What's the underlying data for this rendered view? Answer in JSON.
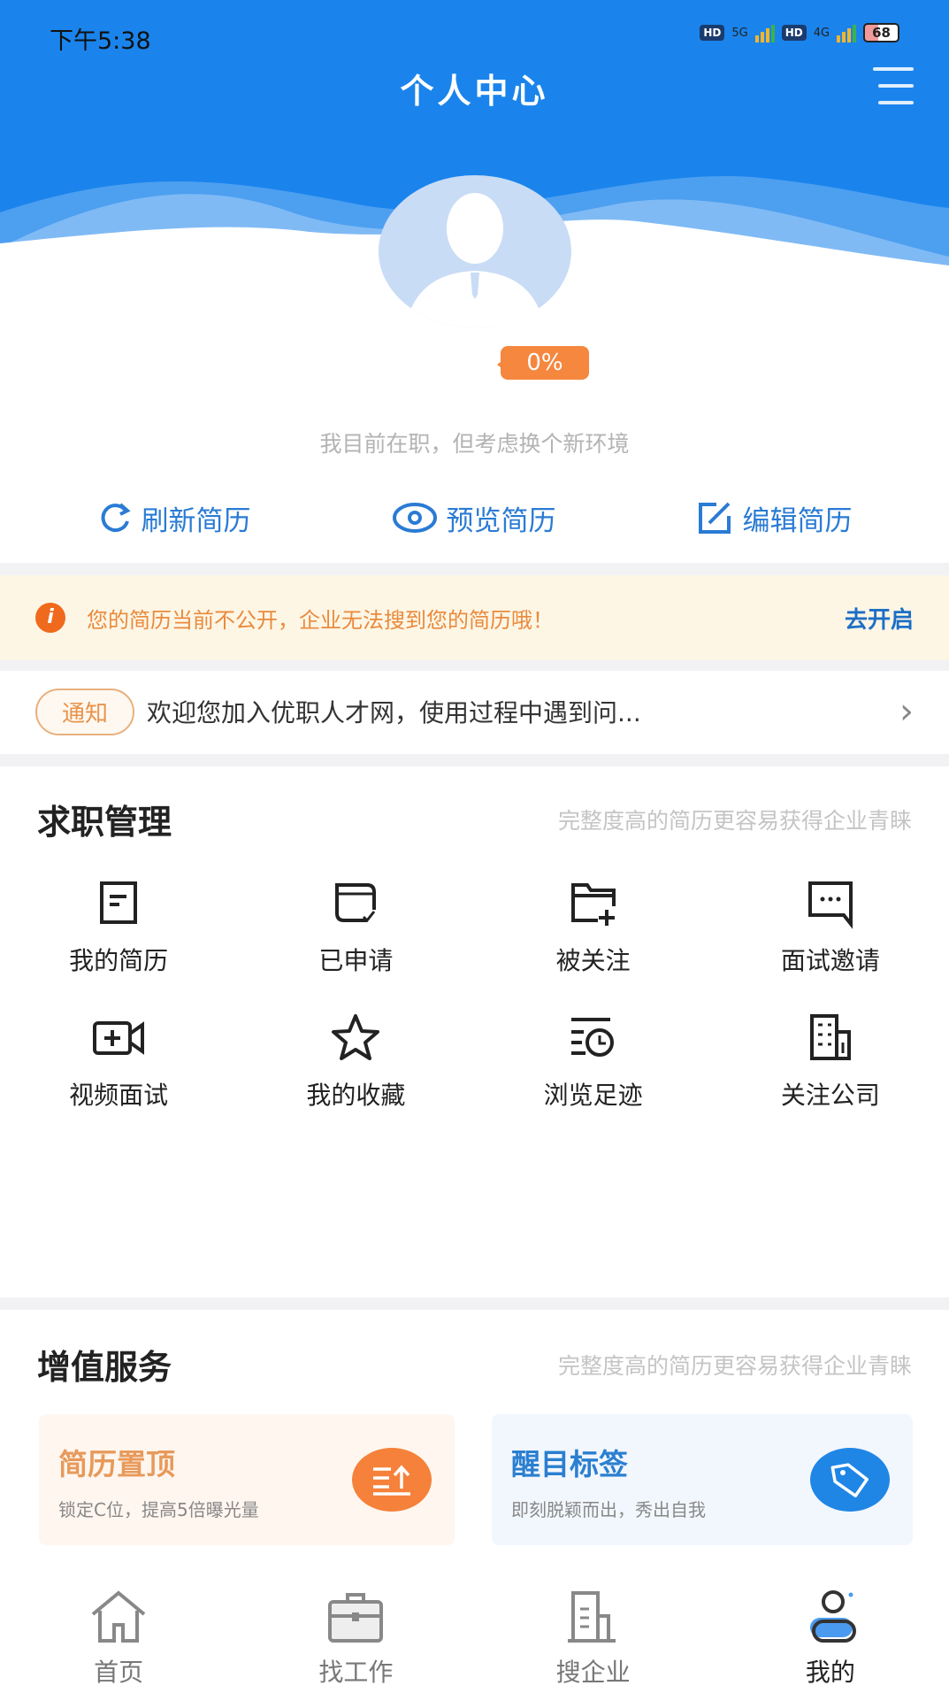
{
  "status_bar": {
    "time": "下午5:38",
    "hd1": "HD",
    "net1": "5G",
    "hd2": "HD",
    "net2": "4G",
    "battery": "68"
  },
  "header": {
    "title": "个人中心",
    "menu_icon": "menu-icon"
  },
  "profile": {
    "completion": "0%",
    "completion_value": 0,
    "job_intent": "我目前在职，但考虑换个新环境"
  },
  "actions": [
    {
      "label": "刷新简历",
      "icon": "refresh-icon"
    },
    {
      "label": "预览简历",
      "icon": "eye-icon"
    },
    {
      "label": "编辑简历",
      "icon": "edit-icon"
    }
  ],
  "warning": {
    "text": "您的简历当前不公开，企业无法搜到您的简历哦！",
    "link": "去开启"
  },
  "notice": {
    "tag": "通知",
    "text": "欢迎您加入优职人才网，使用过程中遇到问..."
  },
  "job_management": {
    "title": "求职管理",
    "subtitle": "完整度高的简历更容易获得企业青睐",
    "items": [
      {
        "label": "我的简历"
      },
      {
        "label": "已申请"
      },
      {
        "label": "被关注"
      },
      {
        "label": "面试邀请"
      },
      {
        "label": "视频面试"
      },
      {
        "label": "我的收藏"
      },
      {
        "label": "浏览足迹"
      },
      {
        "label": "关注公司"
      }
    ]
  },
  "value_services": {
    "title": "增值服务",
    "subtitle": "完整度高的简历更容易获得企业青睐",
    "cards": [
      {
        "title": "简历置顶",
        "desc": "锁定C位，提高5倍曝光量",
        "color": "#f5813a"
      },
      {
        "title": "醒目标签",
        "desc": "即刻脱颖而出，秀出自我",
        "color": "#1f86e6"
      }
    ]
  },
  "bottom_nav": [
    {
      "label": "首页"
    },
    {
      "label": "找工作"
    },
    {
      "label": "搜企业"
    },
    {
      "label": "我的",
      "active": true
    }
  ],
  "colors": {
    "primary": "#1a84ec",
    "orange": "#f5873f",
    "link": "#1d6fc6"
  }
}
